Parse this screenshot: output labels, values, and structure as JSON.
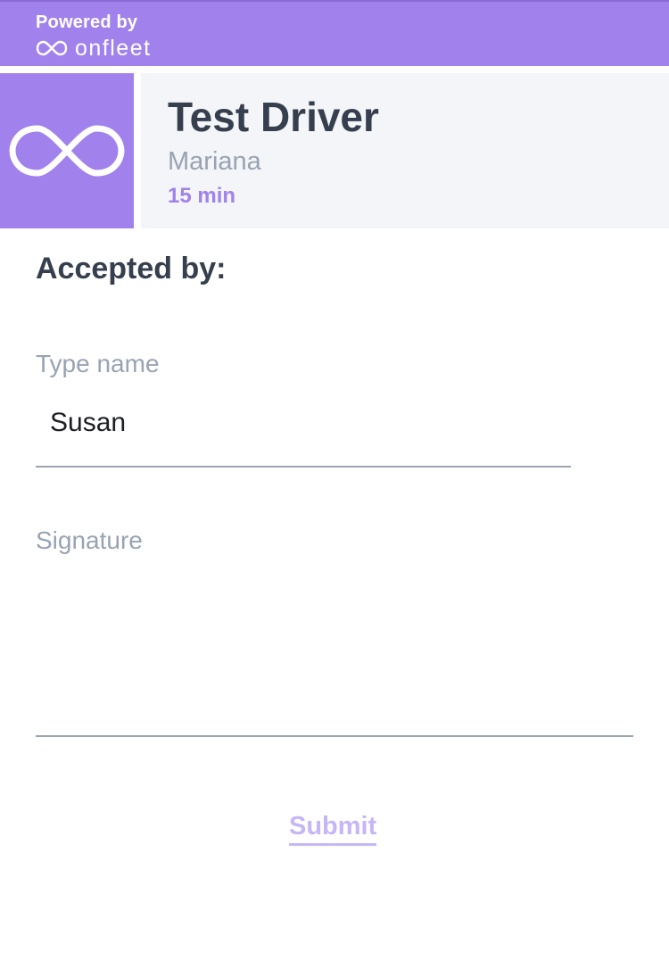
{
  "branding": {
    "powered_by": "Powered by",
    "brand_name": "onfleet",
    "logo_icon": "infinity-icon",
    "brand_color": "#a182ed"
  },
  "driver": {
    "name": "Test Driver",
    "subtitle": "Mariana",
    "eta": "15 min",
    "avatar_icon": "infinity-icon"
  },
  "form": {
    "title": "Accepted by:",
    "name_label": "Type name",
    "name_value": "Susan",
    "signature_label": "Signature",
    "submit_label": "Submit"
  },
  "colors": {
    "accent": "#a182ed",
    "heading": "#363f4d",
    "muted": "#98a3b3",
    "submit_disabled": "#c6b6f6"
  }
}
